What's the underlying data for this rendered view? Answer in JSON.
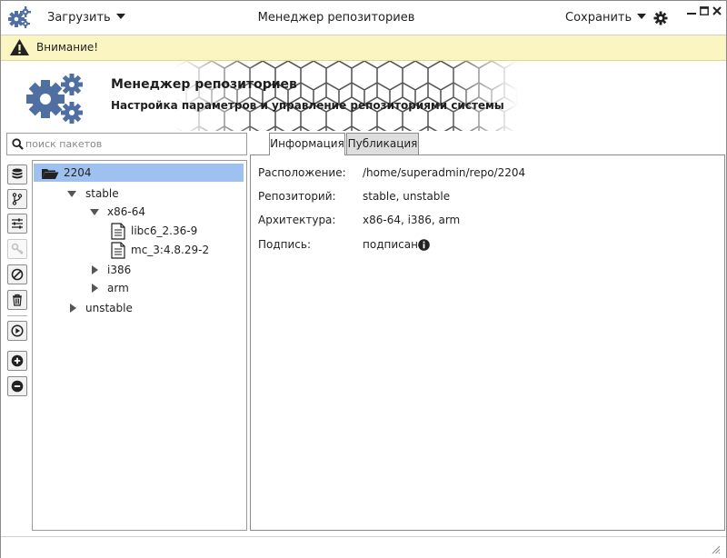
{
  "titlebar": {
    "menu_load": "Загрузить",
    "title": "Менеджер репозиториев",
    "menu_save": "Сохранить"
  },
  "warning": {
    "text": "Внимание!"
  },
  "header": {
    "title": "Менеджер репозиториев",
    "subtitle": "Настройка параметров и управление репозиториями системы"
  },
  "search": {
    "placeholder": "поиск пакетов",
    "value": ""
  },
  "toolbar_icons": [
    "database-icon",
    "branch-icon",
    "sliders-icon",
    "key-icon",
    "block-icon",
    "trash-icon",
    "play-icon",
    "plus-icon",
    "minus-icon"
  ],
  "tree": {
    "root": "2204",
    "stable": "stable",
    "x86": "x86-64",
    "pkg1": "libc6_2.36-9",
    "pkg2": "mc_3:4.8.29-2",
    "i386": "i386",
    "arm": "arm",
    "unstable": "unstable"
  },
  "tabs": {
    "info": "Информация",
    "publish": "Публикация"
  },
  "info": {
    "location_label": "Расположение:",
    "location_value": "/home/superadmin/repo/2204",
    "repo_label": "Репозиторий:",
    "repo_value": "stable, unstable",
    "arch_label": "Архитектура:",
    "arch_value": "x86-64, i386, arm",
    "sign_label": "Подпись:",
    "sign_value": "подписан"
  },
  "colors": {
    "accent": "#4f6fa3",
    "selection": "#9fc1f0",
    "warning_bg": "#fbf5c2"
  }
}
